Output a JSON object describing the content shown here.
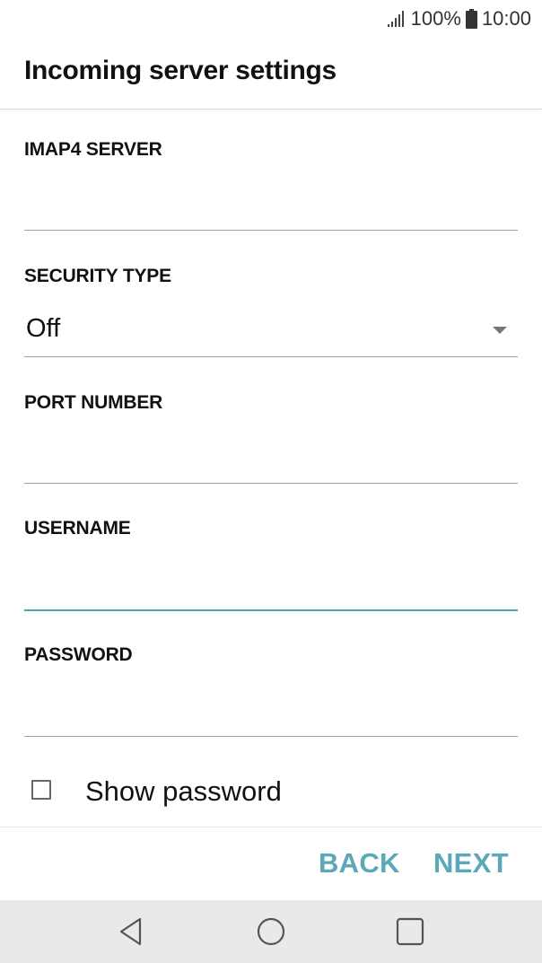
{
  "status_bar": {
    "battery_percent": "100%",
    "time": "10:00",
    "icons": [
      "signal-icon",
      "battery-icon"
    ]
  },
  "header": {
    "title": "Incoming server settings"
  },
  "form": {
    "imap_server": {
      "label": "IMAP4 SERVER",
      "value": ""
    },
    "security_type": {
      "label": "SECURITY TYPE",
      "value": "Off"
    },
    "port_number": {
      "label": "PORT NUMBER",
      "value": ""
    },
    "username": {
      "label": "USERNAME",
      "value": "",
      "focused": true
    },
    "password": {
      "label": "PASSWORD",
      "value": ""
    },
    "show_password": {
      "label": "Show password",
      "checked": false
    }
  },
  "actions": {
    "back_label": "BACK",
    "next_label": "NEXT"
  },
  "nav_bar": {
    "icons": [
      "back-icon",
      "home-icon",
      "recent-apps-icon"
    ]
  },
  "colors": {
    "accent": "#5aa8b8",
    "focused_underline": "#4aa3b2",
    "nav_bar_bg": "#e9e9e9"
  }
}
